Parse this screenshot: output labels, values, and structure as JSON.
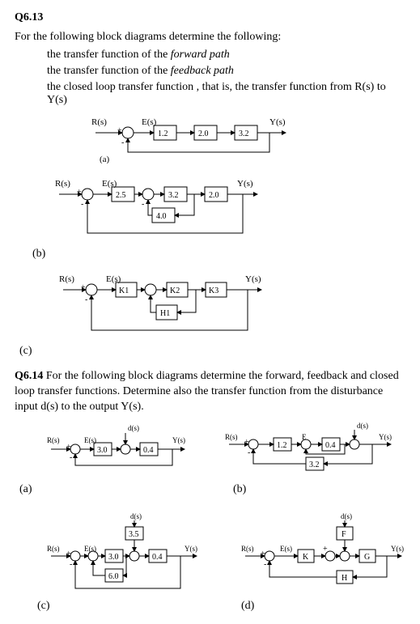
{
  "q613": {
    "number": "Q6.13",
    "intro": "For the following block diagrams determine the following:",
    "bullets": [
      "the transfer function of the",
      "the transfer function of the",
      "the closed loop transfer function , that is, the transfer function from R(s) to Y(s)"
    ],
    "ital1": "forward path",
    "ital2": "feedback path",
    "labels": {
      "a": "(a)",
      "b": "(b)",
      "c": "(c)"
    },
    "sig": {
      "R": "R(s)",
      "E": "E(s)",
      "Y": "Y(s)"
    },
    "diag_a": {
      "b1": "1.2",
      "b2": "2.0",
      "b3": "3.2"
    },
    "diag_b": {
      "b1": "2.5",
      "b2": "3.2",
      "b3": "2.0",
      "b4": "4.0"
    },
    "diag_c": {
      "b1": "K1",
      "b2": "K2",
      "b3": "K3",
      "h1": "H1"
    }
  },
  "q614": {
    "number": "Q6.14",
    "intro": " For the following block diagrams determine the forward, feedback and closed loop transfer functions. Determine also the transfer function from the disturbance input d(s) to the output Y(s).",
    "labels": {
      "a": "(a)",
      "b": "(b)",
      "c": "(c)",
      "d": "(d)"
    },
    "sig": {
      "R": "R(s)",
      "E": "E(s)",
      "Y": "Y(s)",
      "d": "d(s)"
    },
    "diag_a": {
      "b1": "3.0",
      "b2": "0.4"
    },
    "diag_b": {
      "b1": "1.2",
      "b2": "0.4",
      "b3": "3.2"
    },
    "diag_c": {
      "b1": "3.0",
      "b2": "0.4",
      "b3": "6.0",
      "b4": "3.5"
    },
    "diag_d": {
      "f": "F",
      "k": "K",
      "g": "G",
      "h": "H"
    }
  },
  "chart_data": [
    {
      "type": "block-diagram",
      "id": "Q6.13(a)",
      "input": "R(s)",
      "output": "Y(s)",
      "forward_blocks": [
        "1.2",
        "2.0",
        "3.2"
      ],
      "feedback_blocks": [],
      "feedback_sign": "-",
      "notes": "Unity negative feedback around series chain 1.2·2.0·3.2"
    },
    {
      "type": "block-diagram",
      "id": "Q6.13(b)",
      "input": "R(s)",
      "output": "Y(s)",
      "forward_blocks": [
        "2.5",
        "3.2",
        "2.0"
      ],
      "inner_feedback": {
        "around": "3.2",
        "block": "4.0",
        "sign": "-"
      },
      "outer_feedback": {
        "block": null,
        "unity": true,
        "sign": "-"
      }
    },
    {
      "type": "block-diagram",
      "id": "Q6.13(c)",
      "input": "R(s)",
      "output": "Y(s)",
      "forward_blocks": [
        "K1",
        "K2",
        "K3"
      ],
      "feedback_blocks": [
        "H1"
      ],
      "feedback_tap": "after K2",
      "feedback_enters": "between K1 and K2",
      "outer_feedback": {
        "unity": true,
        "sign": "-"
      }
    },
    {
      "type": "block-diagram",
      "id": "Q6.14(a)",
      "input": "R(s)",
      "disturbance": "d(s)",
      "output": "Y(s)",
      "forward_blocks": [
        "3.0",
        "0.4"
      ],
      "disturbance_injection": "between 3.0 and 0.4 (additive)",
      "feedback": {
        "unity": true,
        "sign": "-"
      }
    },
    {
      "type": "block-diagram",
      "id": "Q6.14(b)",
      "input": "R(s)",
      "disturbance": "d(s)",
      "output": "Y(s)",
      "forward_blocks": [
        "1.2",
        "0.4"
      ],
      "disturbance_injection": "at output Y(s) (additive)",
      "feedback": {
        "block": "3.2",
        "sign": "-"
      }
    },
    {
      "type": "block-diagram",
      "id": "Q6.14(c)",
      "input": "R(s)",
      "disturbance": "d(s)",
      "output": "Y(s)",
      "forward_blocks": [
        "3.0",
        "0.4"
      ],
      "disturbance_path_block": "3.5",
      "disturbance_injection": "between 3.0 and 0.4 (additive, via 3.5)",
      "inner_feedback": {
        "around": "3.0",
        "block": "6.0",
        "sign": "-"
      },
      "outer_feedback": {
        "unity": true,
        "sign": "-"
      }
    },
    {
      "type": "block-diagram",
      "id": "Q6.14(d)",
      "input": "R(s)",
      "disturbance": "d(s)",
      "output": "Y(s)",
      "forward_blocks": [
        "K",
        "G"
      ],
      "disturbance_path_block": "F",
      "disturbance_injection": "between K and G (additive, via F)",
      "feedback": {
        "block": "H",
        "sign": "-"
      }
    }
  ]
}
